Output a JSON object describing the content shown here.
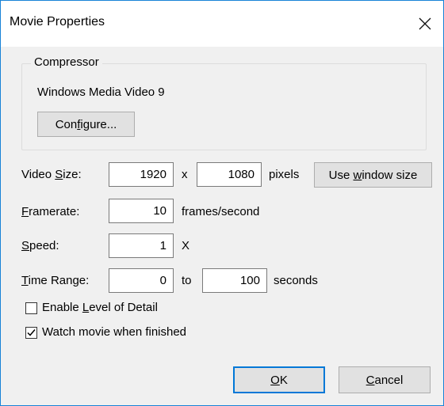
{
  "window": {
    "title": "Movie Properties"
  },
  "compressor": {
    "group_label": "Compressor",
    "codec": "Windows Media Video 9",
    "configure_label": {
      "pre": "Con",
      "u": "f",
      "post": "igure..."
    }
  },
  "video_size": {
    "label": {
      "pre": "Video ",
      "u": "S",
      "post": "ize:"
    },
    "width": "1920",
    "x_sep": "x",
    "height": "1080",
    "unit": "pixels",
    "use_window_btn": {
      "pre": "Use ",
      "u": "w",
      "post": "indow size"
    }
  },
  "framerate": {
    "label": {
      "pre": "",
      "u": "F",
      "post": "ramerate:"
    },
    "value": "10",
    "unit": "frames/second"
  },
  "speed": {
    "label": {
      "pre": "",
      "u": "S",
      "post": "peed:"
    },
    "value": "1",
    "unit": "X"
  },
  "time_range": {
    "label": {
      "pre": "",
      "u": "T",
      "post": "ime Range:"
    },
    "start": "0",
    "to": "to",
    "end": "100",
    "unit": "seconds"
  },
  "options": {
    "level_of_detail": {
      "pre": "Enable ",
      "u": "L",
      "post": "evel of Detail",
      "checked": false
    },
    "watch_movie": {
      "pre": "Watch movie when finished",
      "u": "",
      "post": "",
      "checked": true
    }
  },
  "buttons": {
    "ok": {
      "pre": "",
      "u": "O",
      "post": "K"
    },
    "cancel": {
      "pre": "",
      "u": "C",
      "post": "ancel"
    }
  }
}
